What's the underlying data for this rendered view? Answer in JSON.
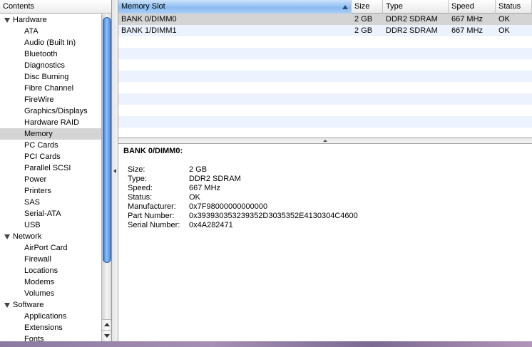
{
  "sidebar": {
    "header": "Contents",
    "groups": [
      {
        "label": "Hardware",
        "items": [
          "ATA",
          "Audio (Built In)",
          "Bluetooth",
          "Diagnostics",
          "Disc Burning",
          "Fibre Channel",
          "FireWire",
          "Graphics/Displays",
          "Hardware RAID",
          "Memory",
          "PC Cards",
          "PCI Cards",
          "Parallel SCSI",
          "Power",
          "Printers",
          "SAS",
          "Serial-ATA",
          "USB"
        ]
      },
      {
        "label": "Network",
        "items": [
          "AirPort Card",
          "Firewall",
          "Locations",
          "Modems",
          "Volumes"
        ]
      },
      {
        "label": "Software",
        "items": [
          "Applications",
          "Extensions",
          "Fonts"
        ]
      }
    ],
    "selected": "Memory"
  },
  "table": {
    "columns": [
      "Memory Slot",
      "Size",
      "Type",
      "Speed",
      "Status"
    ],
    "sorted_column": "Memory Slot",
    "rows": [
      [
        "BANK 0/DIMM0",
        "2 GB",
        "DDR2 SDRAM",
        "667 MHz",
        "OK"
      ],
      [
        "BANK 1/DIMM1",
        "2 GB",
        "DDR2 SDRAM",
        "667 MHz",
        "OK"
      ]
    ]
  },
  "detail": {
    "title": "BANK 0/DIMM0:",
    "fields": [
      {
        "label": "Size:",
        "value": "2 GB"
      },
      {
        "label": "Type:",
        "value": "DDR2 SDRAM"
      },
      {
        "label": "Speed:",
        "value": "667 MHz"
      },
      {
        "label": "Status:",
        "value": "OK"
      },
      {
        "label": "Manufacturer:",
        "value": "0x7F98000000000000"
      },
      {
        "label": "Part Number:",
        "value": "0x393930353239352D3035352E4130304C4600"
      },
      {
        "label": "Serial Number:",
        "value": "0x4A282471"
      }
    ]
  },
  "colors": {
    "selection": "#d4d4d4",
    "stripe": "#edf3fe",
    "scroll_thumb": "#3c79d8"
  }
}
